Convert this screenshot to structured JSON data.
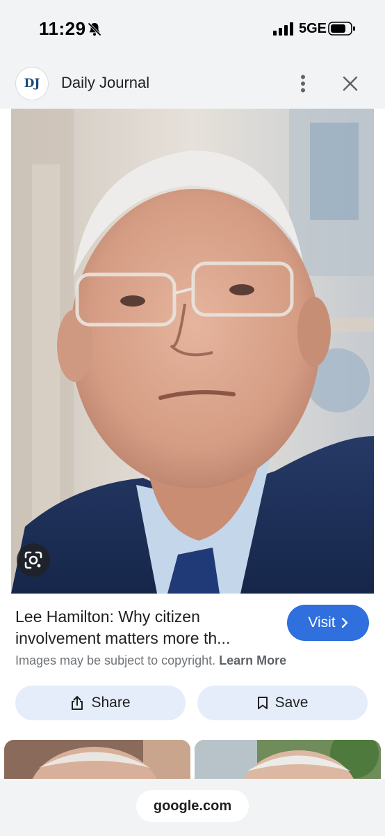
{
  "status_bar": {
    "time": "11:29",
    "network": "5GE"
  },
  "source": {
    "logo_text": "DJ",
    "name": "Daily Journal"
  },
  "result": {
    "title": "Lee Hamilton: Why citizen involvement matters more th...",
    "visit_label": "Visit",
    "copyright_text": "Images may be subject to copyright.",
    "learn_more_label": "Learn More"
  },
  "actions": {
    "share_label": "Share",
    "save_label": "Save"
  },
  "bottom_bar": {
    "domain": "google.com"
  },
  "icons": {
    "bell": "bell-slash-icon",
    "signal": "cellular-signal-icon",
    "battery": "battery-icon",
    "more": "more-vert-icon",
    "close": "close-icon",
    "lens": "google-lens-icon",
    "share": "share-icon",
    "save": "bookmark-icon",
    "visit": "chevron-right-icon"
  },
  "colors": {
    "accent": "#2f6fde",
    "chip_background": "#e5edfb",
    "bar_background": "#f1f3f4"
  }
}
